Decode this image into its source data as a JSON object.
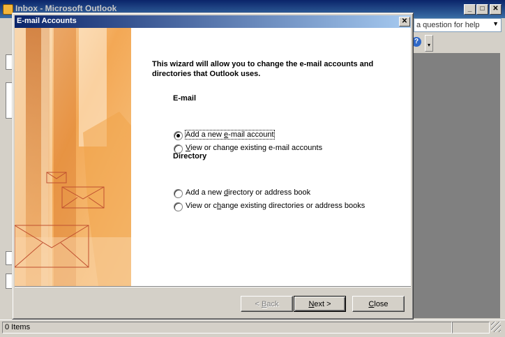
{
  "main": {
    "title": "Inbox - Microsoft Outlook",
    "ask_placeholder": "a question for help",
    "help_glyph": "?",
    "status": "0 Items"
  },
  "dialog": {
    "title": "E-mail Accounts",
    "intro": "This wizard will allow you to change the e-mail accounts and directories that Outlook uses.",
    "email_heading": "E-mail",
    "directory_heading": "Directory",
    "options": [
      {
        "pre": "Add a new ",
        "key": "e",
        "post": "-mail account",
        "checked": true
      },
      {
        "pre": "",
        "key": "V",
        "post": "iew or change existing e-mail accounts",
        "checked": false
      },
      {
        "pre": "Add a new ",
        "key": "d",
        "post": "irectory or address book",
        "checked": false
      },
      {
        "pre": "View or c",
        "key": "h",
        "post": "ange existing directories or address books",
        "checked": false
      }
    ],
    "buttons": {
      "back": {
        "pre": "< ",
        "key": "B",
        "post": "ack"
      },
      "next": {
        "pre": "",
        "key": "N",
        "post": "ext >"
      },
      "close": {
        "pre": "",
        "key": "C",
        "post": "lose"
      }
    }
  },
  "icons": [
    "outlook-icon",
    "minimize-icon",
    "maximize-icon",
    "close-icon",
    "help-icon",
    "dropdown-arrow-icon",
    "envelope-icon",
    "radio-icon"
  ],
  "colors": {
    "title_blue": "#0a246a",
    "dialog_face": "#d4d0c8",
    "art_orange": "#f0a040",
    "envelope_stroke": "#c05030"
  }
}
